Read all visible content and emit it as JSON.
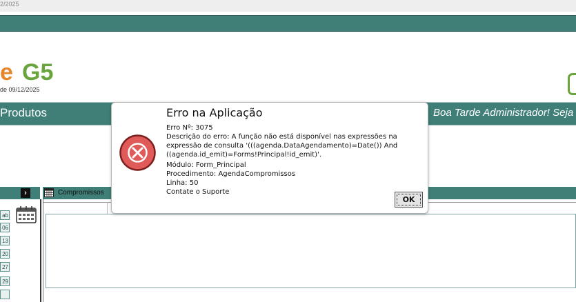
{
  "top_strip": {
    "date_fragment": "2/2025"
  },
  "brand": {
    "letter": "e",
    "name": "G5",
    "version": "de 09/12/2025"
  },
  "nav": {
    "produtos_label": "Produtos",
    "greeting": "Boa Tarde Administrador! Seja"
  },
  "sidebar": {
    "expand_label": "›",
    "days": [
      "ab",
      "06",
      "13",
      "20",
      "27",
      "29",
      ""
    ]
  },
  "compromissos": {
    "title": "Compromissos"
  },
  "dialog": {
    "title": "Erro na Aplicação",
    "lines": [
      "Erro Nº: 3075",
      "Descrição do erro: A função não está disponível nas expressões na",
      "expressão de consulta '(((agenda.DataAgendamento)=Date()) And",
      "((agenda.id_emit)=Forms!Principal!id_emit)'.",
      "Módulo: Form_Principal",
      "Procedimento: AgendaCompromissos",
      "Linha: 50",
      "Contate o Suporte"
    ],
    "ok_label": "OK"
  },
  "colors": {
    "teal": "#3f7f78",
    "brand_orange": "#e8862c",
    "brand_green": "#6aa43c",
    "error_red": "#e05a5a"
  }
}
